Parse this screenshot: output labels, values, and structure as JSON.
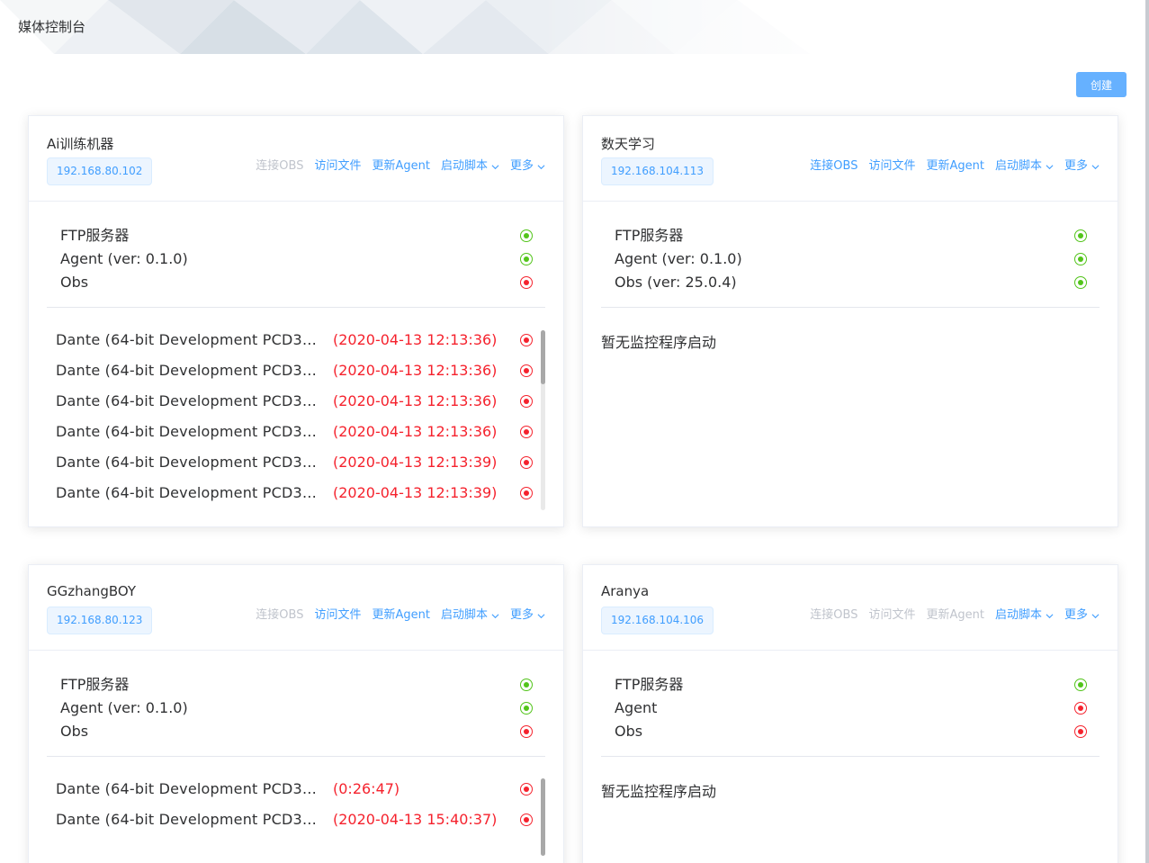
{
  "header": {
    "title": "媒体控制台"
  },
  "toolbar": {
    "create_label": "创建"
  },
  "colors": {
    "primary": "#409eff",
    "ok": "#52c41a",
    "error": "#f5222d",
    "disabled": "#c0c4cc"
  },
  "cards": [
    {
      "name": "Ai训练机器",
      "ip": "192.168.80.102",
      "actions": [
        {
          "label": "连接OBS",
          "enabled": false
        },
        {
          "label": "访问文件",
          "enabled": true
        },
        {
          "label": "更新Agent",
          "enabled": true
        },
        {
          "label": "启动脚本",
          "enabled": true,
          "dropdown": true
        },
        {
          "label": "更多",
          "enabled": true,
          "dropdown": true
        }
      ],
      "status": [
        {
          "label": "FTP服务器",
          "state": "ok"
        },
        {
          "label": "Agent (ver: 0.1.0)",
          "state": "ok"
        },
        {
          "label": "Obs",
          "state": "error"
        }
      ],
      "processes": [
        {
          "name": "Dante (64-bit Development PCD3D...",
          "time": "(2020-04-13 12:13:36)",
          "state": "error"
        },
        {
          "name": "Dante (64-bit Development PCD3D...",
          "time": "(2020-04-13 12:13:36)",
          "state": "error"
        },
        {
          "name": "Dante (64-bit Development PCD3D...",
          "time": "(2020-04-13 12:13:36)",
          "state": "error"
        },
        {
          "name": "Dante (64-bit Development PCD3D...",
          "time": "(2020-04-13 12:13:36)",
          "state": "error"
        },
        {
          "name": "Dante (64-bit Development PCD3D...",
          "time": "(2020-04-13 12:13:39)",
          "state": "error"
        },
        {
          "name": "Dante (64-bit Development PCD3D...",
          "time": "(2020-04-13 12:13:39)",
          "state": "error"
        }
      ],
      "empty_text": ""
    },
    {
      "name": "数天学习",
      "ip": "192.168.104.113",
      "actions": [
        {
          "label": "连接OBS",
          "enabled": true
        },
        {
          "label": "访问文件",
          "enabled": true
        },
        {
          "label": "更新Agent",
          "enabled": true
        },
        {
          "label": "启动脚本",
          "enabled": true,
          "dropdown": true
        },
        {
          "label": "更多",
          "enabled": true,
          "dropdown": true
        }
      ],
      "status": [
        {
          "label": "FTP服务器",
          "state": "ok"
        },
        {
          "label": "Agent (ver: 0.1.0)",
          "state": "ok"
        },
        {
          "label": "Obs (ver: 25.0.4)",
          "state": "ok"
        }
      ],
      "processes": [],
      "empty_text": "暂无监控程序启动"
    },
    {
      "name": "GGzhangBOY",
      "ip": "192.168.80.123",
      "actions": [
        {
          "label": "连接OBS",
          "enabled": false
        },
        {
          "label": "访问文件",
          "enabled": true
        },
        {
          "label": "更新Agent",
          "enabled": true
        },
        {
          "label": "启动脚本",
          "enabled": true,
          "dropdown": true
        },
        {
          "label": "更多",
          "enabled": true,
          "dropdown": true
        }
      ],
      "status": [
        {
          "label": "FTP服务器",
          "state": "ok"
        },
        {
          "label": "Agent (ver: 0.1.0)",
          "state": "ok"
        },
        {
          "label": "Obs",
          "state": "error"
        }
      ],
      "processes": [
        {
          "name": "Dante (64-bit Development PCD3D...",
          "time": "(0:26:47)",
          "state": "error"
        },
        {
          "name": "Dante (64-bit Development PCD3D...",
          "time": "(2020-04-13 15:40:37)",
          "state": "error"
        }
      ],
      "empty_text": ""
    },
    {
      "name": "Aranya",
      "ip": "192.168.104.106",
      "actions": [
        {
          "label": "连接OBS",
          "enabled": false
        },
        {
          "label": "访问文件",
          "enabled": false
        },
        {
          "label": "更新Agent",
          "enabled": false
        },
        {
          "label": "启动脚本",
          "enabled": true,
          "dropdown": true
        },
        {
          "label": "更多",
          "enabled": true,
          "dropdown": true
        }
      ],
      "status": [
        {
          "label": "FTP服务器",
          "state": "ok"
        },
        {
          "label": "Agent",
          "state": "error"
        },
        {
          "label": "Obs",
          "state": "error"
        }
      ],
      "processes": [],
      "empty_text": "暂无监控程序启动"
    }
  ]
}
